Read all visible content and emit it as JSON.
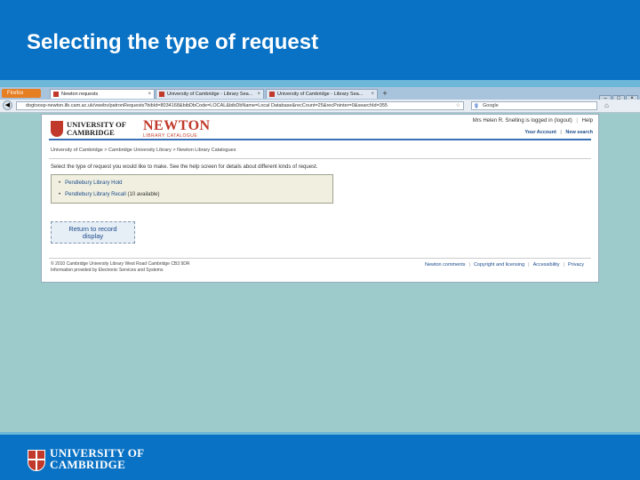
{
  "slide": {
    "title": "Selecting the type of request",
    "footer_logo_line1": "UNIVERSITY OF",
    "footer_logo_line2": "CAMBRIDGE"
  },
  "browser": {
    "menu_button": "Firefox",
    "tabs": [
      {
        "label": "Newton requests",
        "active": true
      },
      {
        "label": "University of Cambridge - Library Sea...",
        "active": false
      },
      {
        "label": "University of Cambridge - Library Sea...",
        "active": false
      }
    ],
    "url": "dogtoosp-newton.lib.cam.ac.uk/vwebv/patronRequests?bibId=8034168&bibDbCode=LOCAL&bibDbName=Local Database&recCount=25&recPointer=0&searchId=355",
    "search_engine": "Google"
  },
  "page": {
    "logo_line1": "UNIVERSITY OF",
    "logo_line2": "CAMBRIDGE",
    "catalogue_title": "NEWTON",
    "catalogue_subtitle": "LIBRARY CATALOGUE",
    "login_status": "Mrs Helen R. Snelling is logged in (logout)",
    "help_link": "Help",
    "your_account_link": "Your Account",
    "new_search_link": "New search",
    "breadcrumb": "University of Cambridge  >  Cambridge University Library  >  Newton Library Catalogues",
    "instruction": "Select the type of request you would like to make. See the help screen for details about different kinds of request.",
    "request_options": [
      {
        "label": "Pendlebury Library Hold",
        "note": ""
      },
      {
        "label": "Pendlebury Library Recall",
        "note": "(10 available)"
      }
    ],
    "return_button_line1": "Return to record",
    "return_button_line2": "display",
    "copyright": "© 2010 Cambridge University Library West Road Cambridge CB3 9DR",
    "info_provided": "Information provided by Electronic Services and Systems",
    "footer_links": [
      "Newton comments",
      "Copyright and licensing",
      "Accessibility",
      "Privacy"
    ]
  },
  "colors": {
    "slide_blue": "#0a72c4",
    "background": "#9dcbcb",
    "cambridge_red": "#c0392b",
    "link_blue": "#1a4a8a"
  }
}
